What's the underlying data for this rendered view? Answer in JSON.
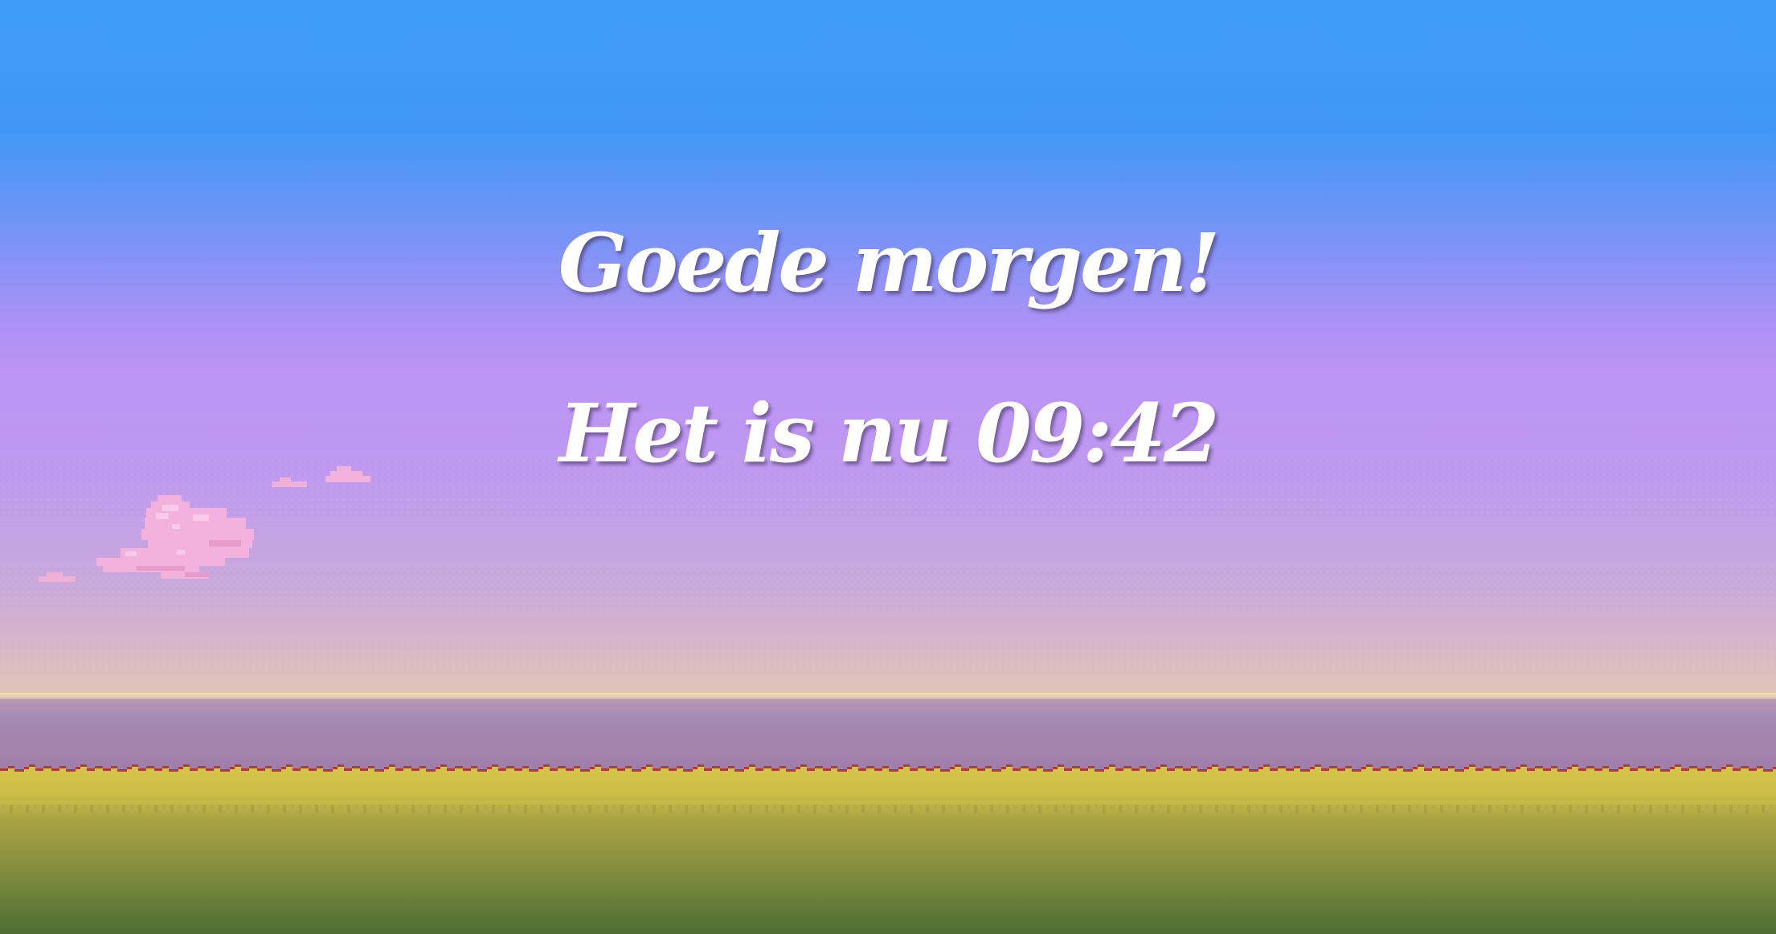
{
  "greeting": {
    "line1": "Goede morgen!",
    "line2": "Het is nu 09:42"
  },
  "colors": {
    "sky_top": "#3f9cf7",
    "sky_mid": "#bc94f5",
    "horizon": "#e7d2ab",
    "water": "#a382ab",
    "grass": "#d4c34a",
    "ground_bottom": "#4e6d35",
    "cloud": "#f5b3df",
    "text": "#ffffff"
  }
}
